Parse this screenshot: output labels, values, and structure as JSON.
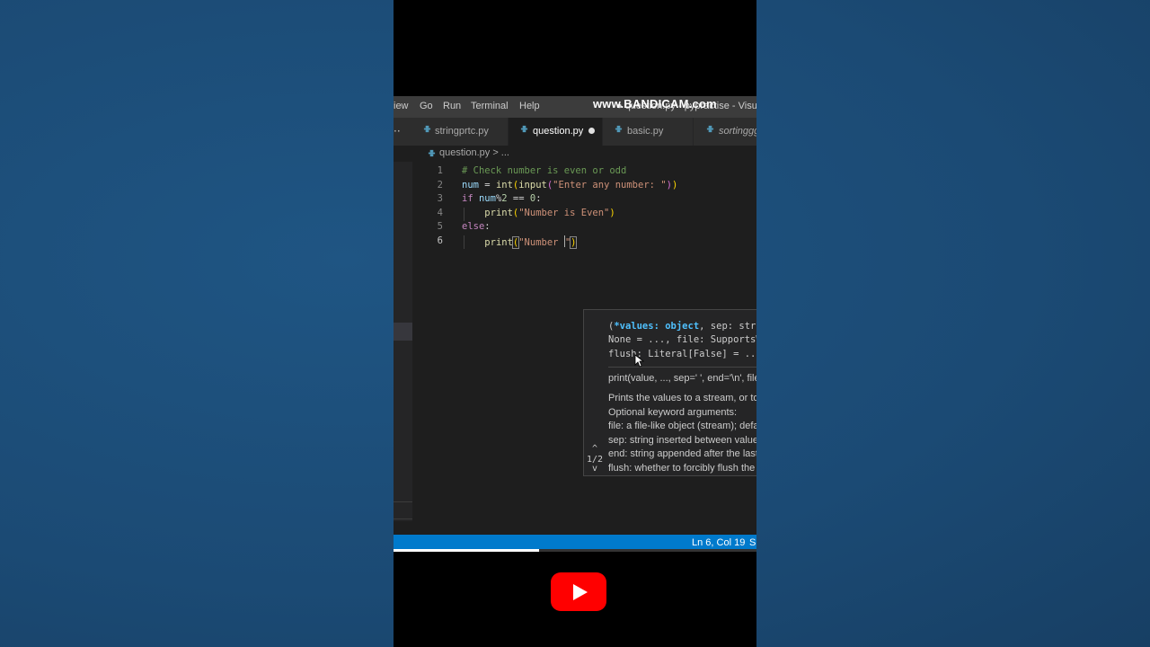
{
  "menubar": {
    "items": [
      "iew",
      "Go",
      "Run",
      "Terminal",
      "Help"
    ],
    "window_title": "● question.py - pypractise - Visual St",
    "watermark": "www.BANDICAM.com"
  },
  "tabs": [
    {
      "label": "stringprtc.py",
      "active": false,
      "dirty": false
    },
    {
      "label": "question.py",
      "active": true,
      "dirty": true
    },
    {
      "label": "basic.py",
      "active": false,
      "dirty": false
    },
    {
      "label": "sortinggg.",
      "active": false,
      "dirty": false
    }
  ],
  "sidebar_more": "··",
  "breadcrumb": "question.py > ...",
  "editor": {
    "line_numbers": [
      "1",
      "2",
      "3",
      "4",
      "5",
      "6"
    ],
    "current_line": 6
  },
  "signature_help": {
    "sig_line1_pre": "(",
    "sig_line1_hl": "*values: object",
    "sig_line1_post": ", sep: str | N",
    "sig_line2": "None = ..., file: SupportsWrit",
    "sig_line3": "flush: Literal[False] = ...) -",
    "doc_sig": "print(value, ..., sep=' ', end='\\n', file=s",
    "doc_lines": [
      "Prints the values to a stream, or to sy",
      "Optional keyword arguments:",
      "file: a file-like object (stream); default",
      "sep: string inserted between values, d",
      "end: string appended after the last va",
      "flush: whether to forcibly flush the str"
    ],
    "overload_counter": "1/2",
    "up_glyph": "^",
    "down_glyph": "v"
  },
  "statusbar": {
    "position": "Ln 6, Col 19",
    "spaces": "Sp"
  },
  "video": {
    "progress_fraction": 0.4
  },
  "colors": {
    "accent": "#007acc",
    "youtube_red": "#ff0000"
  }
}
